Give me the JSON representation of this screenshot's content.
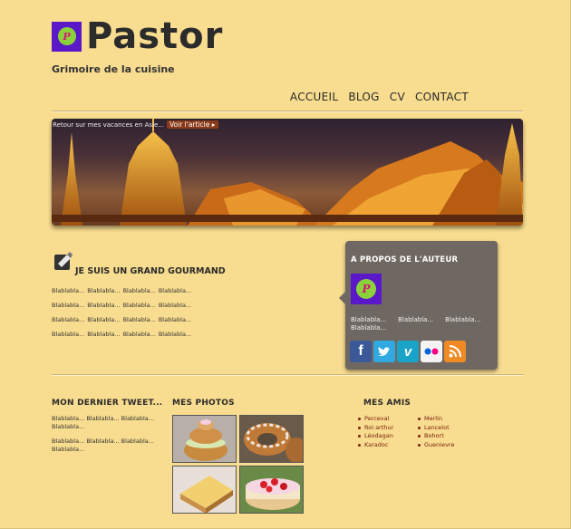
{
  "header": {
    "logo_letter": "P",
    "title": "Pastor",
    "tagline": "Grimoire de la cuisine"
  },
  "nav": {
    "items": [
      "ACCUEIL",
      "BLOG",
      "CV",
      "CONTACT"
    ]
  },
  "hero": {
    "caption": "Retour sur mes vacances en Asie...",
    "link_label": "Voir l'article ▸"
  },
  "gourmand": {
    "title": "JE SUIS UN GRAND GOURMAND",
    "rows": [
      [
        "Blablabla...",
        "Blablabla...",
        "Blablabla...",
        "Blablabla..."
      ],
      [
        "Blablabla...",
        "Blablabla...",
        "Blablabla...",
        "Blablabla..."
      ],
      [
        "Blablabla...",
        "Blablabla...",
        "Blablabla...",
        "Blablabla..."
      ],
      [
        "Blablabla...",
        "Blablabla...",
        "Blablabla...",
        "Blablabla..."
      ]
    ]
  },
  "author": {
    "title": "A PROPOS DE L'AUTEUR",
    "badge_letter": "P",
    "texts": [
      "Blablabla...",
      "Blablabla...",
      "Blablabla...",
      "Blablabla..."
    ],
    "socials": [
      {
        "icon": "facebook-icon",
        "glyph": "f",
        "color": "#3b5998"
      },
      {
        "icon": "twitter-icon",
        "glyph": "t",
        "color": "#2fa9e0"
      },
      {
        "icon": "vimeo-icon",
        "glyph": "v",
        "color": "#1aa3c8"
      },
      {
        "icon": "flickr-icon",
        "glyph": "••",
        "color": "#f4f4f4"
      },
      {
        "icon": "rss-icon",
        "glyph": ")",
        "color": "#f08a24"
      }
    ]
  },
  "tweet": {
    "title": "MON DERNIER TWEET...",
    "paragraphs": [
      "Blablabla... Blablabla... Blablabla... Blablabla...",
      "Blablabla... Blablabla... Blablabla... Blablabla..."
    ]
  },
  "photos": {
    "title": "MES PHOTOS",
    "items": [
      {
        "icon": "cream-puff-photo"
      },
      {
        "icon": "paris-brest-photo"
      },
      {
        "icon": "tart-slice-photo"
      },
      {
        "icon": "strawberry-cake-photo"
      }
    ]
  },
  "friends": {
    "title": "MES AMIS",
    "items": [
      "Perceval",
      "Merlin",
      "Roi arthur",
      "Lancelot",
      "Léodagan",
      "Bohort",
      "Karadoc",
      "Guenievre"
    ]
  }
}
